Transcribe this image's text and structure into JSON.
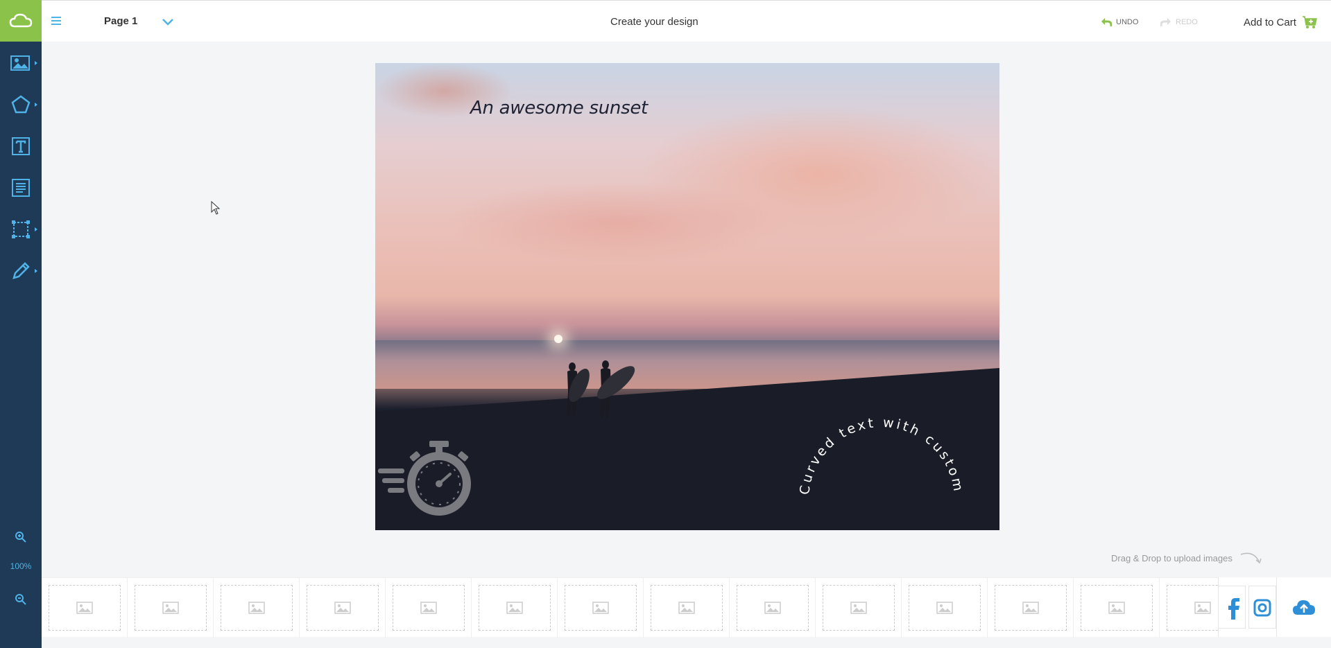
{
  "header": {
    "page_label": "Page 1",
    "title": "Create your design",
    "undo_label": "UNDO",
    "redo_label": "REDO",
    "cart_label": "Add to Cart"
  },
  "sidebar": {
    "tools": [
      {
        "name": "images-tool",
        "icon": "image-icon"
      },
      {
        "name": "shapes-tool",
        "icon": "pentagon-icon"
      },
      {
        "name": "text-tool",
        "icon": "text-icon"
      },
      {
        "name": "text-block-tool",
        "icon": "paragraph-icon"
      },
      {
        "name": "frame-tool",
        "icon": "frame-icon"
      },
      {
        "name": "draw-tool",
        "icon": "pencil-icon"
      }
    ],
    "zoom_level": "100%"
  },
  "canvas": {
    "headline": "An awesome sunset",
    "curved_text": "Curved text with custom font"
  },
  "upload": {
    "drag_hint": "Drag & Drop to upload images"
  },
  "colors": {
    "sidebar": "#1f3a56",
    "brand_green": "#8bc34a",
    "accent_blue": "#4fb3e8"
  }
}
